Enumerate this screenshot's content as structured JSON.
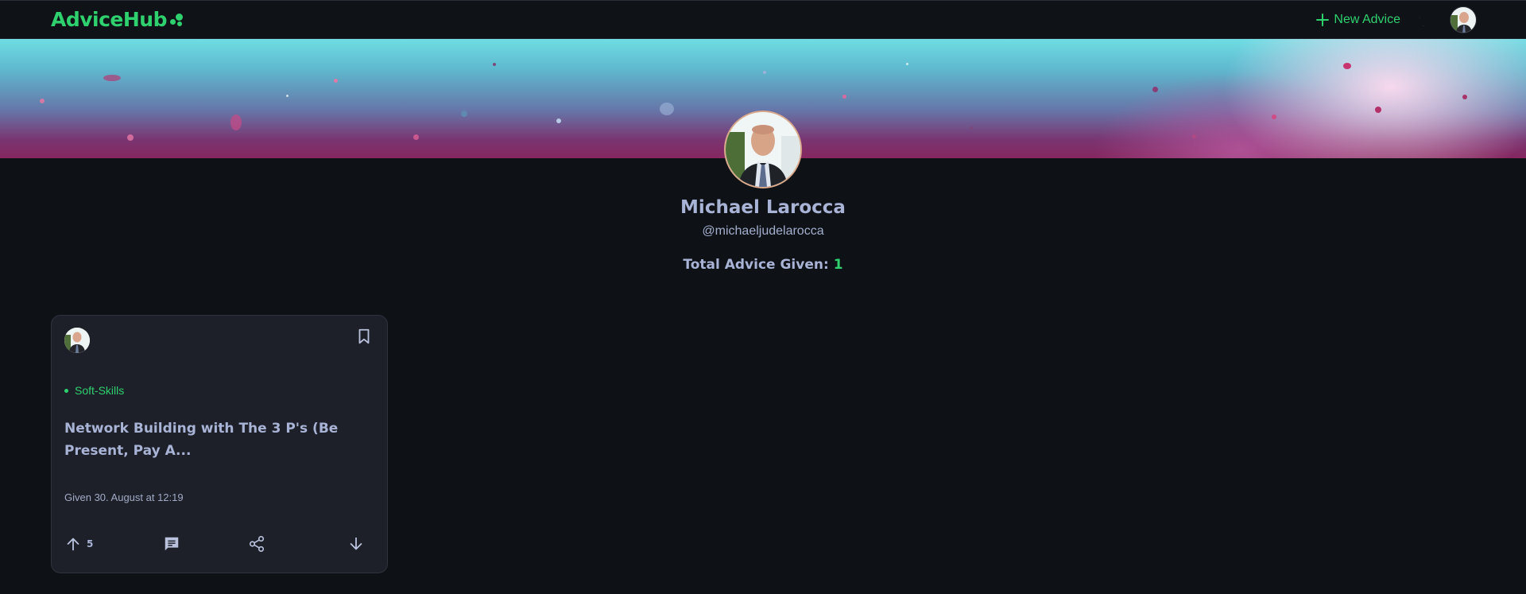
{
  "header": {
    "logo_text": "AdviceHub",
    "new_advice_label": "New Advice",
    "accent_color": "#2fd16f"
  },
  "profile": {
    "name": "Michael Larocca",
    "handle": "@michaeljudelarocca",
    "total_advice_label": "Total Advice Given:",
    "total_advice_count": "1"
  },
  "cards": [
    {
      "tag": "Soft-Skills",
      "title": "Network Building with The 3 P's (Be Present, Pay A...",
      "date": "Given 30. August at 12:19",
      "upvotes": "5"
    }
  ],
  "icons": {
    "plus": "plus-icon",
    "theme_toggle": "moon-icon",
    "bookmark": "bookmark-icon",
    "upvote": "arrow-up-icon",
    "comment": "comment-icon",
    "share": "share-icon",
    "downvote": "arrow-down-icon"
  }
}
